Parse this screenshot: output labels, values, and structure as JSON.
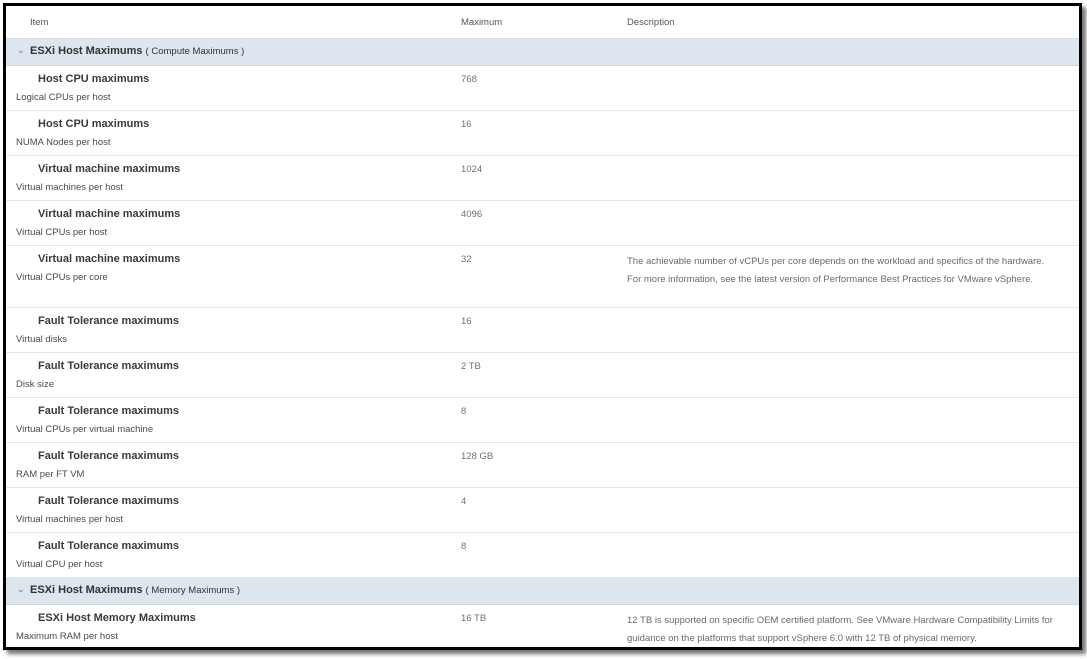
{
  "header": {
    "item": "Item",
    "maximum": "Maximum",
    "description": "Description"
  },
  "groups": [
    {
      "title": "ESXi Host Maximums",
      "subtitle": "( Compute Maximums )",
      "rows": [
        {
          "title": "Host CPU maximums",
          "sub": "Logical CPUs per host",
          "max": "768",
          "desc": ""
        },
        {
          "title": "Host CPU maximums",
          "sub": "NUMA Nodes per host",
          "max": "16",
          "desc": ""
        },
        {
          "title": "Virtual machine maximums",
          "sub": "Virtual machines per host",
          "max": "1024",
          "desc": ""
        },
        {
          "title": "Virtual machine maximums",
          "sub": "Virtual CPUs per host",
          "max": "4096",
          "desc": ""
        },
        {
          "title": "Virtual machine maximums",
          "sub": "Virtual CPUs per core",
          "max": "32",
          "desc": "The achievable number of vCPUs per core depends on the workload and specifics of the hardware. For more information, see the latest version of Performance Best Practices for VMware vSphere."
        },
        {
          "title": "Fault Tolerance maximums",
          "sub": "Virtual disks",
          "max": "16",
          "desc": ""
        },
        {
          "title": "Fault Tolerance maximums",
          "sub": "Disk size",
          "max": "2 TB",
          "desc": ""
        },
        {
          "title": "Fault Tolerance maximums",
          "sub": "Virtual CPUs per virtual machine",
          "max": "8",
          "desc": ""
        },
        {
          "title": "Fault Tolerance maximums",
          "sub": "RAM per FT VM",
          "max": "128 GB",
          "desc": ""
        },
        {
          "title": "Fault Tolerance maximums",
          "sub": "Virtual machines per host",
          "max": "4",
          "desc": ""
        },
        {
          "title": "Fault Tolerance maximums",
          "sub": "Virtual CPU per host",
          "max": "8",
          "desc": ""
        }
      ]
    },
    {
      "title": "ESXi Host Maximums",
      "subtitle": "( Memory Maximums )",
      "rows": [
        {
          "title": "ESXi Host Memory Maximums",
          "sub": "Maximum RAM per host",
          "max": "16 TB",
          "desc": "12 TB is supported on specific OEM certified platform. See VMware Hardware Compatibility Limits for guidance on the platforms that support vSphere 6.0 with 12 TB of physical memory."
        }
      ]
    }
  ]
}
